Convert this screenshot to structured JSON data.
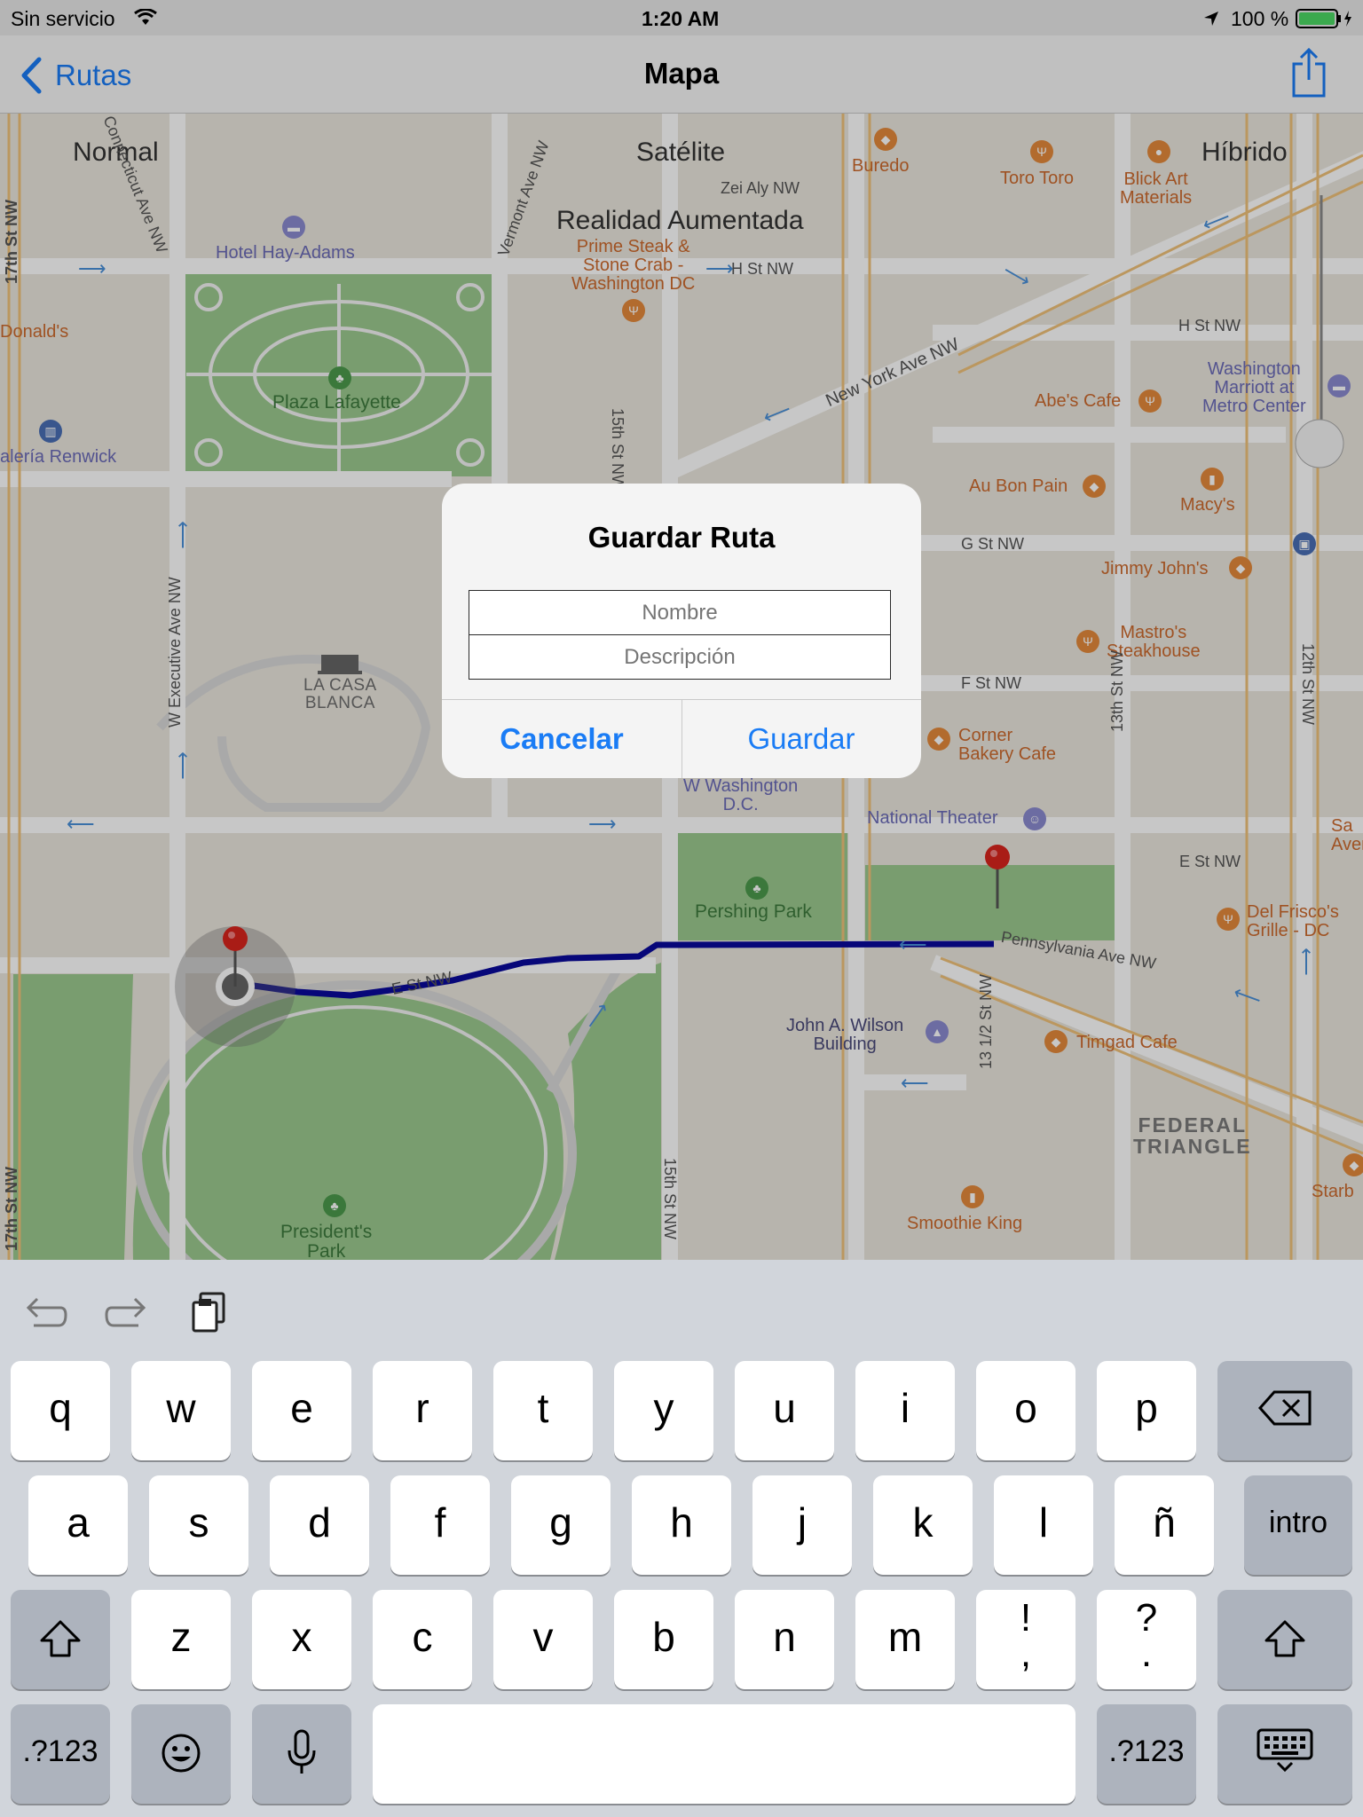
{
  "status_bar": {
    "carrier": "Sin servicio",
    "time": "1:20 AM",
    "battery": "100 %"
  },
  "nav": {
    "back_label": "Rutas",
    "title": "Mapa",
    "share_icon": "share-icon"
  },
  "map": {
    "segments": [
      "Normal",
      "Satélite",
      "Híbrido",
      "Realidad Aumentada"
    ],
    "pois": {
      "buredo": "Buredo",
      "toro_toro": "Toro Toro",
      "blick_art": "Blick Art\nMaterials",
      "hotel_hay_adams": "Hotel Hay-Adams",
      "prime_steak": "Prime Steak &\nStone Crab -\nWashington DC",
      "donalds": "Donald's",
      "plaza_lafayette": "Plaza Lafayette",
      "galeria_renwick": "alería Renwick",
      "abes_cafe": "Abe's Cafe",
      "washington_marriott": "Washington\nMarriott at\nMetro Center",
      "au_bon_pain": "Au Bon Pain",
      "macys": "Macy's",
      "jimmy_johns": "Jimmy John's",
      "mastros": "Mastro's\nSteakhouse",
      "la_casa_blanca": "LA CASA\nBLANCA",
      "corner_bakery": "Corner\nBakery Cafe",
      "w_washington": "W Washington\nD.C.",
      "national_theater": "National Theater",
      "pershing_park": "Pershing Park",
      "del_frisco": "Del Frisco's\nGrille - DC",
      "john_wilson": "John A. Wilson\nBuilding",
      "timgad_cafe": "Timgad Cafe",
      "federal_triangle": "FEDERAL\nTRIANGLE",
      "smoothie_king": "Smoothie King",
      "presidents_park": "President's\nPark",
      "starbucks": "Starb",
      "sa_aven": "Sa\nAven"
    },
    "streets": {
      "zei_aly": "Zei Aly NW",
      "h_st_1": "H St NW",
      "h_st_2": "H St NW",
      "new_york_ave": "New York Ave NW",
      "g_st": "G St NW",
      "f_st": "F St NW",
      "e_st_1": "E St NW",
      "e_st_2": "E St NW",
      "pennsylvania": "Pennsylvania Ave NW",
      "fifteenth_1": "15th St NW",
      "fifteenth_2": "15th St NW",
      "twelfth": "12th St NW",
      "thirteenth": "13th St NW",
      "thirteen_half": "13 1/2 St NW",
      "seventeenth_1": "17th St NW",
      "seventeenth_2": "17th St NW",
      "w_executive": "W Executive Ave NW",
      "connecticut": "Connecticut Ave NW",
      "vermont": "Vermont Ave NW"
    }
  },
  "alert": {
    "title": "Guardar Ruta",
    "name_placeholder": "Nombre",
    "description_placeholder": "Descripción",
    "cancel_label": "Cancelar",
    "save_label": "Guardar"
  },
  "keyboard": {
    "row1": [
      "q",
      "w",
      "e",
      "r",
      "t",
      "y",
      "u",
      "i",
      "o",
      "p"
    ],
    "row2": [
      "a",
      "s",
      "d",
      "f",
      "g",
      "h",
      "j",
      "k",
      "l",
      "ñ"
    ],
    "row3": [
      "z",
      "x",
      "c",
      "v",
      "b",
      "n",
      "m",
      "!\n,",
      "?\n."
    ],
    "return_label": "intro",
    "numbers_label": ".?123",
    "colors": {
      "key": "#ffffff",
      "func_key": "#adb3bd",
      "background": "#d1d5db",
      "accent": "#1a7cf5",
      "route": "#0a0a9c"
    }
  }
}
